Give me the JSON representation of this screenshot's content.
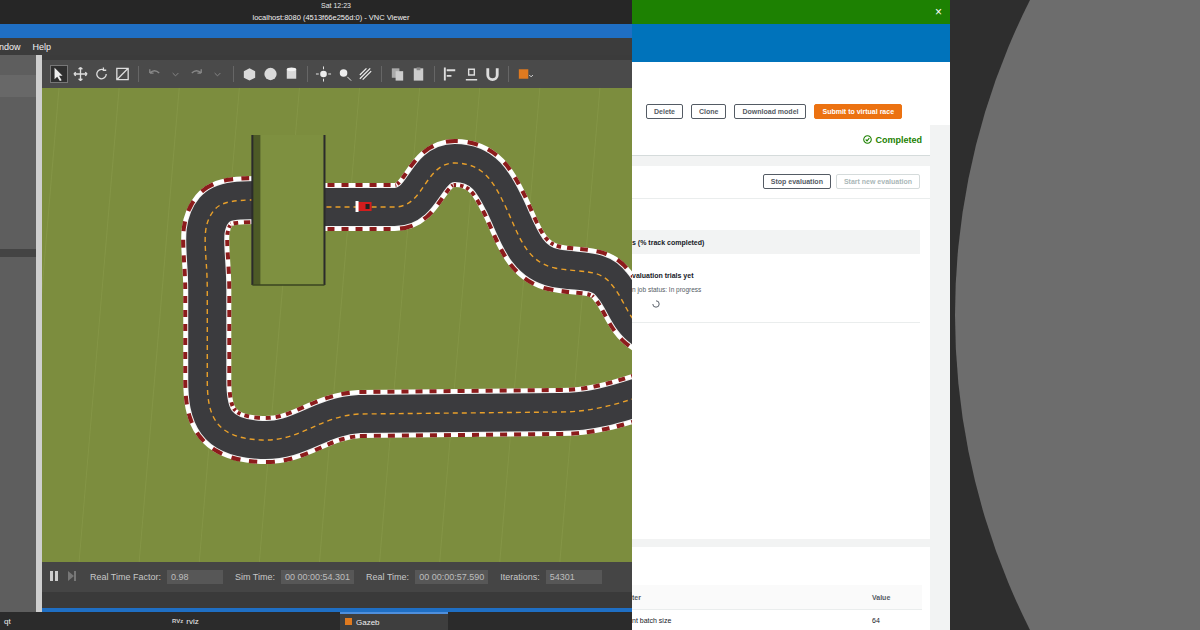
{
  "system_bar": {
    "clock": "Sat 12:23"
  },
  "vnc_window": {
    "title": "localhost:8080 (4513f66e256d:0) - VNC Viewer"
  },
  "gazebo": {
    "menu": [
      "ndow",
      "Help"
    ],
    "status": [
      {
        "label": "Real Time Factor:",
        "value": "0.98"
      },
      {
        "label": "Sim Time:",
        "value": "00 00:00:54.301"
      },
      {
        "label": "Real Time:",
        "value": "00 00:00:57.590"
      },
      {
        "label": "Iterations:",
        "value": "54301"
      }
    ]
  },
  "taskbar": [
    {
      "label": "qt",
      "logo": "",
      "selected": false
    },
    {
      "label": "rviz",
      "logo": "RVz",
      "selected": false
    },
    {
      "label": "Gazeb",
      "logo": "",
      "selected": true
    }
  ],
  "console": {
    "close": "×",
    "actions": [
      {
        "label": "Delete",
        "primary": false
      },
      {
        "label": "Clone",
        "primary": false
      },
      {
        "label": "Download model",
        "primary": false
      },
      {
        "label": "Submit to virtual race",
        "primary": true
      }
    ],
    "training_status": "Completed",
    "evaluation": {
      "buttons": [
        {
          "label": "Stop evaluation",
          "disabled": false
        },
        {
          "label": "Start new evaluation",
          "disabled": true
        }
      ],
      "table_header": "s (% track completed)",
      "empty_title": "valuation trials yet",
      "job_status": "n job status: In progress"
    },
    "hyperparameters": {
      "columns": [
        "ter",
        "Value"
      ],
      "rows": [
        [
          "nt batch size",
          "64"
        ]
      ]
    }
  }
}
